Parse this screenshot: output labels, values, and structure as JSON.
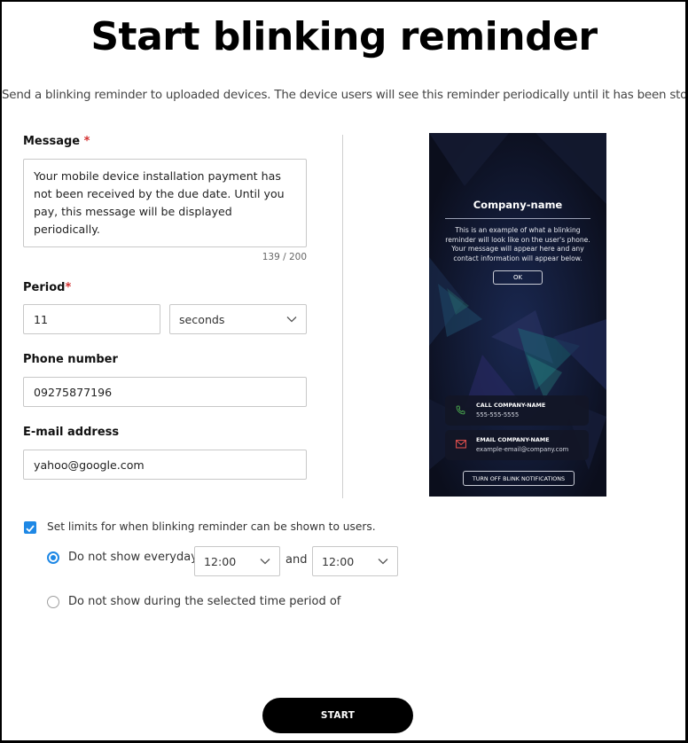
{
  "page": {
    "title": "Start blinking reminder",
    "subtitle": "Send a blinking reminder to uploaded devices. The device users will see this reminder periodically until it has been stopped."
  },
  "form": {
    "message": {
      "label": "Message",
      "required_mark": "*",
      "value": "Your mobile device installation payment has not been received by the due date. Until you pay, this message will be displayed periodically.",
      "counter": "139 / 200"
    },
    "period": {
      "label": "Period",
      "required_mark": "*",
      "value": "11",
      "unit_selected": "seconds"
    },
    "phone": {
      "label": "Phone number",
      "value": "09275877196"
    },
    "email": {
      "label": "E-mail address",
      "value": "yahoo@google.com"
    },
    "limits": {
      "checkbox_label": "Set limits for when blinking reminder can be shown to users.",
      "checked": true,
      "option_everyday": {
        "label": "Do not show everyday",
        "selected": true,
        "from": "12:00",
        "joiner": "and",
        "to": "12:00"
      },
      "option_period": {
        "label": "Do not show during the selected time period of",
        "selected": false
      }
    }
  },
  "preview": {
    "company": "Company-name",
    "body": "This is an example of what a blinking reminder will look like on the user's phone. Your message will appear here and any contact information will appear below.",
    "ok_label": "OK",
    "call_title": "CALL COMPANY-NAME",
    "call_value": "555-555-5555",
    "email_title": "EMAIL COMPANY-NAME",
    "email_value": "example-email@company.com",
    "turn_off_label": "TURN OFF BLINK NOTIFICATIONS"
  },
  "actions": {
    "start_label": "START"
  },
  "colors": {
    "accent": "#1e88e5",
    "required": "#d32f2f",
    "primary_button": "#000000",
    "phone_background": "#0e1224"
  }
}
